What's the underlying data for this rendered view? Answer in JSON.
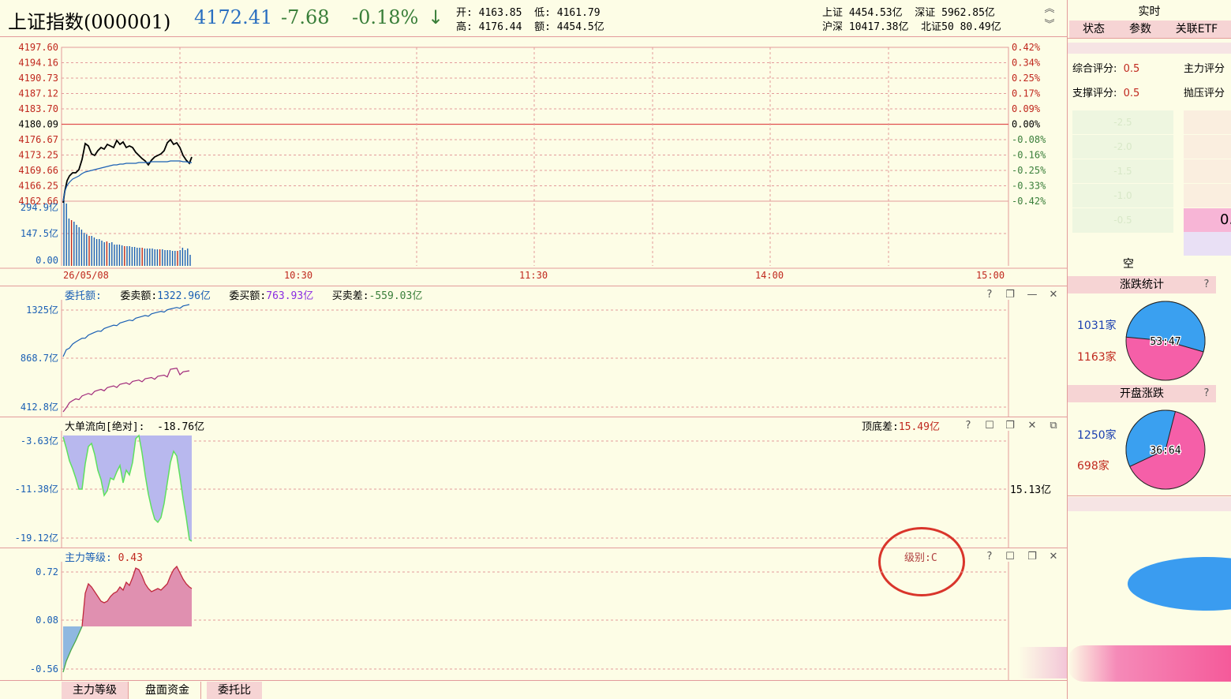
{
  "header": {
    "name": "上证指数(000001)",
    "price": "4172.41",
    "change": "-7.68",
    "pct": "-0.18%",
    "arrow": "↓",
    "open_label": "开:",
    "open": "4163.85",
    "low_label": "低:",
    "low": "4161.79",
    "high_label": "高:",
    "high": "4176.44",
    "amount_label": "额:",
    "amount": "4454.5亿"
  },
  "market": {
    "sh_label": "上证",
    "sh": "4454.53亿",
    "sz_label": "深证",
    "sz": "5962.85亿",
    "hs_label": "沪深",
    "hs": "10417.38亿",
    "bz_label": "北证50",
    "bz": "80.49亿"
  },
  "price_axis": {
    "left": [
      "4197.60",
      "4194.16",
      "4190.73",
      "4187.12",
      "4183.70",
      "4180.09",
      "4176.67",
      "4173.25",
      "4169.66",
      "4166.25",
      "4162.66"
    ],
    "right": [
      "0.42%",
      "0.34%",
      "0.25%",
      "0.17%",
      "0.09%",
      "0.00%",
      "-0.08%",
      "-0.16%",
      "-0.25%",
      "-0.33%",
      "-0.42%"
    ]
  },
  "volume_axis": [
    "294.9亿",
    "147.5亿",
    "0.00"
  ],
  "time_axis": [
    "26/05/08",
    "10:30",
    "11:30",
    "14:00",
    "15:00"
  ],
  "commission": {
    "title": "委托额:",
    "sell_label": "委卖额:",
    "sell": "1322.96亿",
    "buy_label": "委买额:",
    "buy": "763.93亿",
    "diff_label": "买卖差:",
    "diff": "-559.03亿",
    "axis": [
      "1325亿",
      "868.7亿",
      "412.8亿"
    ]
  },
  "bigorder": {
    "title": "大单流向[绝对]:",
    "value": "-18.76亿",
    "topbottom_label": "顶底差:",
    "topbottom": "15.49亿",
    "axis": [
      "-3.63亿",
      "-11.38亿",
      "-19.12亿"
    ],
    "right_value": "15.13亿"
  },
  "mainforce": {
    "title": "主力等级:",
    "value": "0.43",
    "level": "级别:C",
    "axis": [
      "0.72",
      "0.08",
      "-0.56"
    ]
  },
  "bottom_tabs": [
    "主力等级",
    "盘面资金",
    "委托比"
  ],
  "right": {
    "title": "实时",
    "tabs": [
      "状态",
      "参数",
      "关联ETF"
    ],
    "score1_label": "综合评分:",
    "score1": "0.5",
    "score2_label": "主力评分",
    "support_label": "支撑评分:",
    "support": "0.5",
    "pressure_label": "抛压评分",
    "ladder": [
      "-2.5",
      "-2.0",
      "-1.5",
      "-1.0",
      "-0.5"
    ],
    "ladder_value": "0.",
    "empty_label": "空",
    "updown_title": "涨跌统计",
    "updown_up": "1031家",
    "updown_down": "1163家",
    "updown_ratio": "53:47",
    "open_title": "开盘涨跌",
    "open_up": "1250家",
    "open_down": "698家",
    "open_ratio": "36:64",
    "help": "?"
  },
  "colors": {
    "up": "#c0281e",
    "down": "#3a7f3a",
    "blue": "#1a5fb4",
    "grid": "#e39b9b"
  }
}
